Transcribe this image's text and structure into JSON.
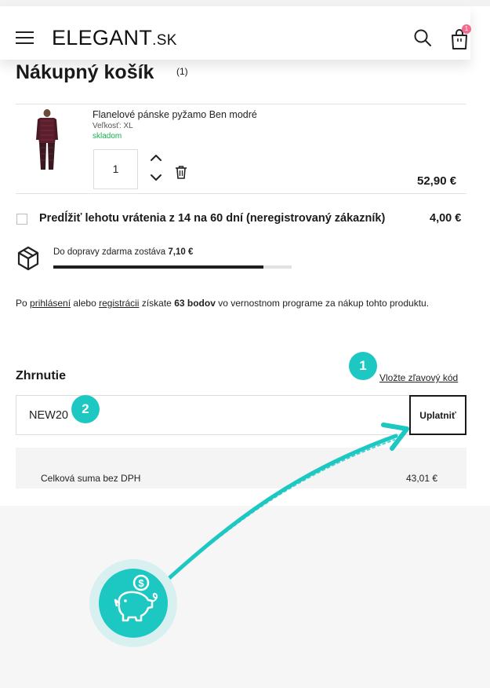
{
  "header": {
    "logo_main": "ELEGANT",
    "logo_suffix": ".SK",
    "cart_count": "1"
  },
  "cart": {
    "title": "Nákupný košík",
    "count": "(1)"
  },
  "product": {
    "name": "Flanelové pánske pyžamo Ben modré",
    "size": "Veľkosť: XL",
    "stock": "skladom",
    "quantity": "1",
    "price": "52,90 €"
  },
  "extension": {
    "label": "Predĺžiť lehotu vrátenia z 14 na 60 dní (neregistrovaný zákazník)",
    "price": "4,00 €"
  },
  "shipping": {
    "text": "Do dopravy zdarma zostáva",
    "amount": "7,10 €",
    "progress_percent": 88
  },
  "loyalty": {
    "prefix": "Po",
    "login_link": "prihlásení",
    "middle": "alebo",
    "register_link": "registrácii",
    "text_before_points": "získate",
    "points": "63 bodov",
    "suffix": "vo vernostnom programe za nákup tohto produktu."
  },
  "summary": {
    "title": "Zhrnutie",
    "coupon_link": "Vložte zľavový kód",
    "coupon_value": "NEW20",
    "apply_label": "Uplatniť",
    "total_label": "Celková suma bez DPH",
    "total_value": "43,01 €"
  },
  "annotations": {
    "callout_1": "1",
    "callout_2": "2",
    "accent_color": "#1ec8c2"
  },
  "colors": {
    "stock_green": "#14b24a",
    "badge_pink": "#f06b8e",
    "progress_dark": "#1e1e1e"
  },
  "icons": [
    "hamburger-menu-icon",
    "search-icon",
    "shopping-bag-icon",
    "chevron-up-icon",
    "chevron-down-icon",
    "trash-icon",
    "package-box-icon",
    "piggy-bank-coin-icon",
    "arrow-icon"
  ]
}
